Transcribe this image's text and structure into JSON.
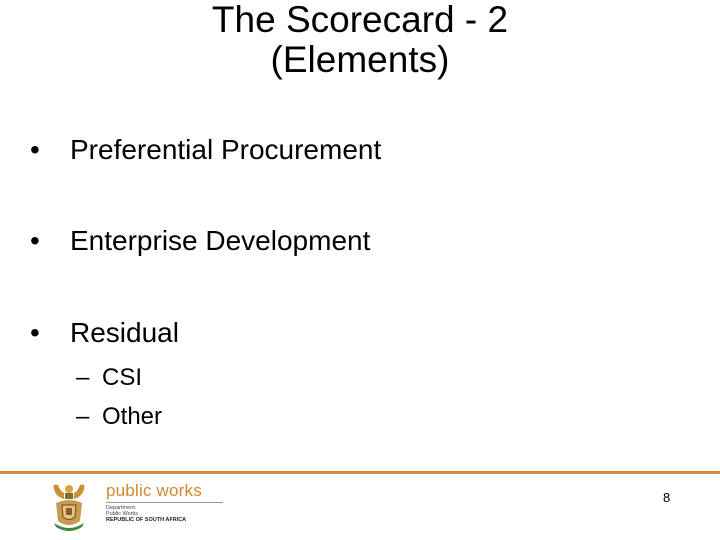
{
  "slide": {
    "title_lines": [
      "The Scorecard - 2",
      "(Elements)"
    ],
    "bullets": [
      {
        "marker": "•",
        "text": "Preferential Procurement"
      },
      {
        "marker": "•",
        "text": "Enterprise Development"
      },
      {
        "marker": "•",
        "text": "Residual",
        "sub_items": [
          {
            "marker": "–",
            "text": "CSI"
          },
          {
            "marker": "–",
            "text": "Other"
          }
        ]
      }
    ],
    "page_number": "8"
  },
  "footer": {
    "logo": {
      "icon": "coat-of-arms-icon",
      "name": "public works",
      "lines": [
        "Department:",
        "Public Works",
        "REPUBLIC OF SOUTH AFRICA"
      ]
    },
    "accent_color": "#d08a3c"
  }
}
